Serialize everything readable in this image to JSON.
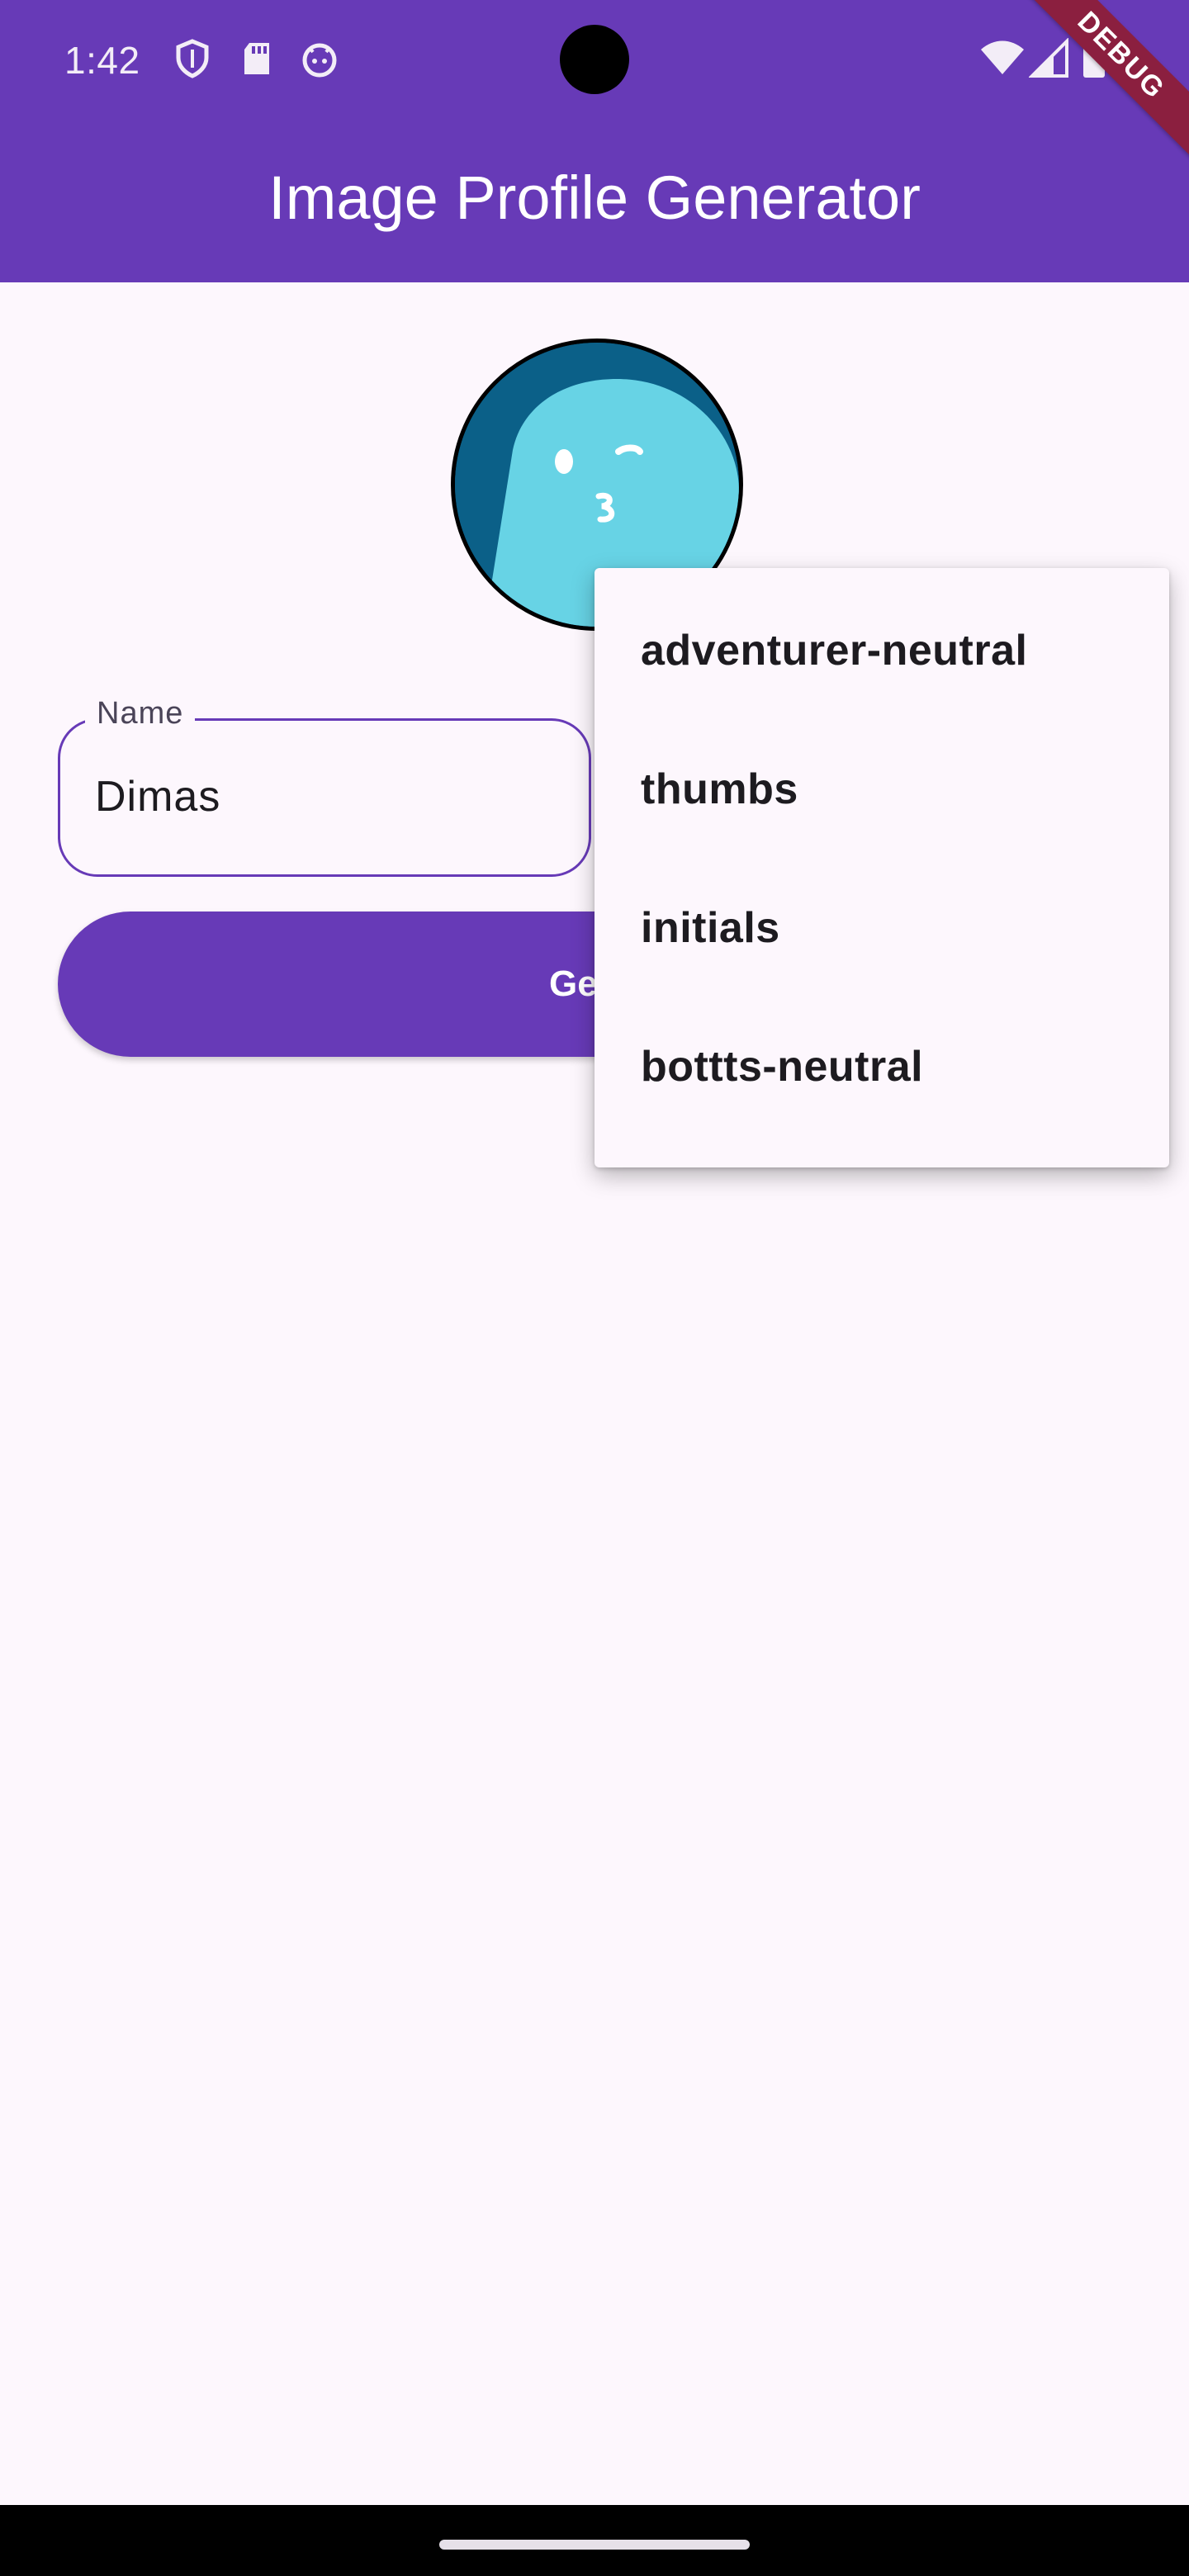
{
  "status_bar": {
    "time": "1:42",
    "icons": [
      "shield-icon",
      "sd-card-icon",
      "android-face-icon",
      "wifi-icon",
      "signal-icon",
      "battery-icon"
    ]
  },
  "app_bar": {
    "title": "Image Profile Generator",
    "color": "#673ab7"
  },
  "debug_banner": {
    "label": "DEBUG"
  },
  "avatar": {
    "icon": "avatar-blob-icon"
  },
  "name_field": {
    "label": "Name",
    "value": "Dimas"
  },
  "generate_button": {
    "label": "Gene"
  },
  "style_menu": {
    "items": [
      {
        "label": "adventurer-neutral"
      },
      {
        "label": "thumbs"
      },
      {
        "label": "initials"
      },
      {
        "label": "bottts-neutral"
      }
    ]
  }
}
